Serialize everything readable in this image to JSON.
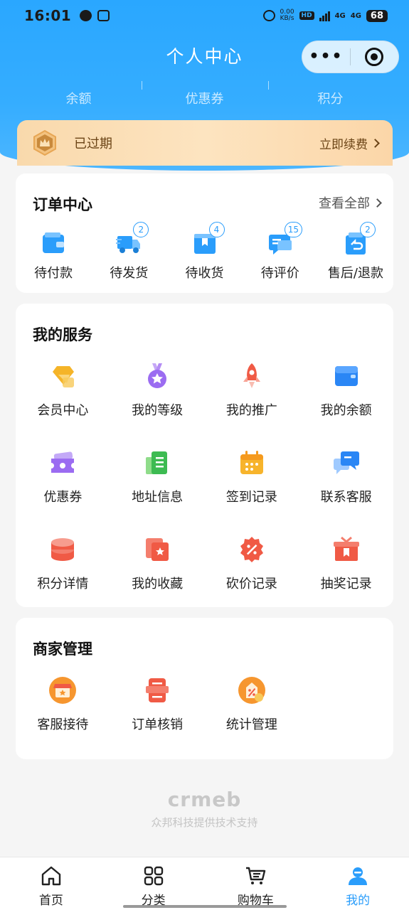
{
  "status_bar": {
    "time": "16:01",
    "net_speed_value": "0.00",
    "net_speed_unit": "KB/s",
    "hd": "HD",
    "sig1": "4G",
    "sig2": "4G",
    "battery": "68"
  },
  "header": {
    "title": "个人中心",
    "more_icon": "more-dots-icon",
    "close_icon": "target-icon",
    "stats": [
      {
        "label": "余额"
      },
      {
        "label": "优惠券"
      },
      {
        "label": "积分"
      }
    ]
  },
  "vip": {
    "status": "已过期",
    "renew": "立即续费"
  },
  "orders": {
    "title": "订单中心",
    "view_all": "查看全部",
    "items": [
      {
        "label": "待付款",
        "badge": ""
      },
      {
        "label": "待发货",
        "badge": "2"
      },
      {
        "label": "待收货",
        "badge": "4"
      },
      {
        "label": "待评价",
        "badge": "15"
      },
      {
        "label": "售后/退款",
        "badge": "2"
      }
    ]
  },
  "services": {
    "title": "我的服务",
    "items": [
      {
        "label": "会员中心",
        "icon": "diamond-icon"
      },
      {
        "label": "我的等级",
        "icon": "medal-icon"
      },
      {
        "label": "我的推广",
        "icon": "rocket-icon"
      },
      {
        "label": "我的余额",
        "icon": "wallet-icon"
      },
      {
        "label": "优惠券",
        "icon": "coupon-icon"
      },
      {
        "label": "地址信息",
        "icon": "address-book-icon"
      },
      {
        "label": "签到记录",
        "icon": "calendar-icon"
      },
      {
        "label": "联系客服",
        "icon": "chat-icon"
      },
      {
        "label": "积分详情",
        "icon": "coins-stack-icon"
      },
      {
        "label": "我的收藏",
        "icon": "favorites-icon"
      },
      {
        "label": "砍价记录",
        "icon": "discount-badge-icon"
      },
      {
        "label": "抽奖记录",
        "icon": "gift-box-icon"
      }
    ]
  },
  "merchant": {
    "title": "商家管理",
    "items": [
      {
        "label": "客服接待",
        "icon": "shop-icon"
      },
      {
        "label": "订单核销",
        "icon": "receipt-icon"
      },
      {
        "label": "统计管理",
        "icon": "stats-bag-icon"
      }
    ]
  },
  "footer": {
    "logo": "crmeb",
    "text": "众邦科技提供技术支持"
  },
  "tabbar": {
    "items": [
      {
        "label": "首页",
        "icon": "home-icon"
      },
      {
        "label": "分类",
        "icon": "grid-icon"
      },
      {
        "label": "购物车",
        "icon": "cart-icon"
      },
      {
        "label": "我的",
        "icon": "user-icon"
      }
    ]
  },
  "colors": {
    "primary": "#2a9dfb",
    "header": "#35adff",
    "vip_gold": "#f9d9ac"
  }
}
